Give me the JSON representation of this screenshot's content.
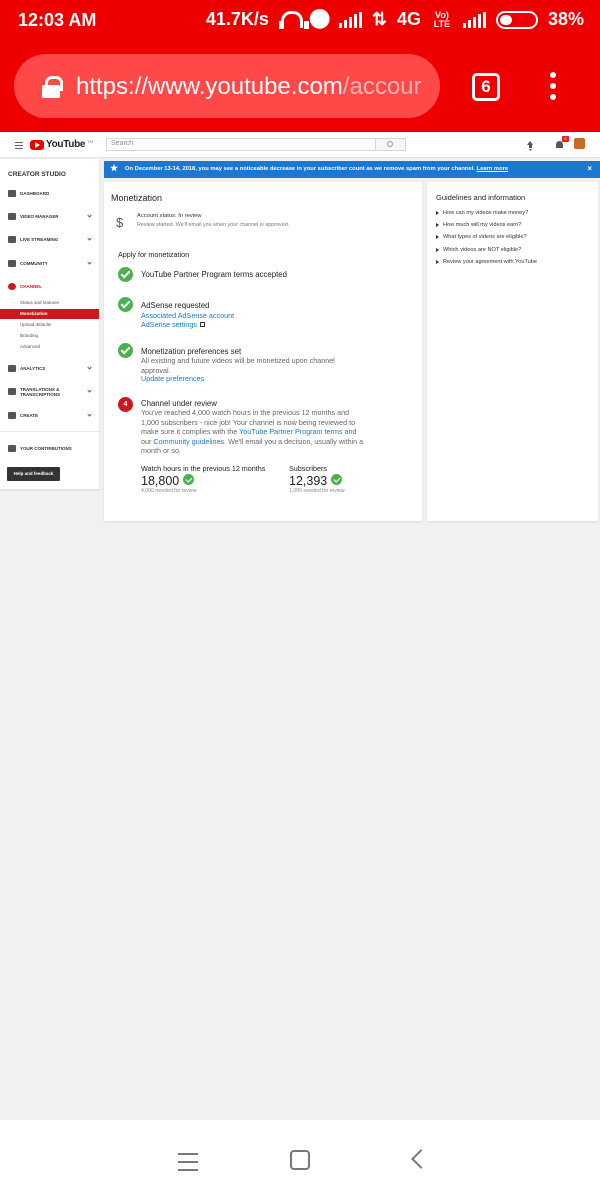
{
  "status_bar": {
    "time": "12:03 AM",
    "speed": "41.7K/s",
    "network": "4G",
    "volte": "Vo) LTE",
    "battery": "38%"
  },
  "browser": {
    "url_main": "https://www.youtube.com",
    "url_path": "/accour",
    "tab_count": "6"
  },
  "header": {
    "logo_text": "YouTube",
    "logo_tm": "TM",
    "search_placeholder": "Search",
    "notification_count": "8"
  },
  "sidebar": {
    "title": "CREATOR STUDIO",
    "items": [
      {
        "label": "DASHBOARD"
      },
      {
        "label": "VIDEO MANAGER"
      },
      {
        "label": "LIVE STREAMING"
      },
      {
        "label": "COMMUNITY"
      },
      {
        "label": "CHANNEL"
      },
      {
        "label": "ANALYTICS"
      },
      {
        "label": "TRANSLATIONS &",
        "label2": "TRANSCRIPTIONS"
      },
      {
        "label": "CREATE"
      },
      {
        "label": "YOUR CONTRIBUTIONS"
      }
    ],
    "sub_items": [
      {
        "label": "Status and features"
      },
      {
        "label": "Monetization"
      },
      {
        "label": "Upload defaults"
      },
      {
        "label": "Branding"
      },
      {
        "label": "Advanced"
      }
    ],
    "help_button": "Help and feedback"
  },
  "banner": {
    "message": "On December 13-14, 2018, you may see a noticeable decrease in your subscriber count as we remove spam from your channel.",
    "link": "Learn more",
    "close": "×"
  },
  "monetization": {
    "title": "Monetization",
    "account_status": "Account status: In review",
    "account_sub": "Review started. We'll email you when your channel is approved.",
    "apply_heading": "Apply for monetization",
    "steps": [
      {
        "title": "YouTube Partner Program terms accepted"
      },
      {
        "title": "AdSense requested",
        "link1": "Associated AdSense account",
        "link2": "AdSense settings"
      },
      {
        "title": "Monetization preferences set",
        "desc": "All existing and future videos will be monetized upon channel approval.",
        "link1": "Update preferences"
      },
      {
        "number": "4",
        "title": "Channel under review",
        "desc_a": "You've reached 4,000 watch hours in the previous 12 months and 1,000 subscribers - nice job! Your channel is now being reviewed to make sure it complies with the ",
        "desc_link1": "YouTube Partner Program terms",
        "desc_b": " and our ",
        "desc_link2": "Community guidelines",
        "desc_c": ". We'll email you a decision, usually within a month or so."
      }
    ],
    "metrics": [
      {
        "label": "Watch hours in the previous 12 months",
        "value": "18,800",
        "note": "4,000 needed for review"
      },
      {
        "label": "Subscribers",
        "value": "12,393",
        "note": "1,000 needed for review"
      }
    ]
  },
  "guidelines": {
    "title": "Guidelines and information",
    "items": [
      {
        "label": "How can my videos make money?"
      },
      {
        "label": "How much will my videos earn?"
      },
      {
        "label": "What types of videos are eligible?"
      },
      {
        "label": "Which videos are NOT eligible?"
      },
      {
        "label": "Review your agreement with YouTube"
      }
    ]
  },
  "colors": {
    "browser_red": "#ee0000",
    "banner_blue": "#1b77d0",
    "youtube_red": "#cc181e",
    "success_green": "#4caf50",
    "link_blue": "#167ac6"
  }
}
